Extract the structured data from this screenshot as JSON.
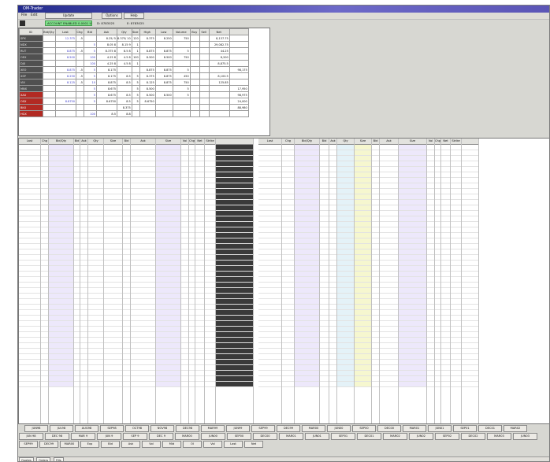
{
  "window": {
    "title": "OM-Trader"
  },
  "menubar": {
    "items": [
      "File",
      "Edit"
    ],
    "tool_buttons": [
      "Update",
      "Options",
      "Help"
    ]
  },
  "toolbar": {
    "green_label": "ACCOUNT ENABLED 0.0001 USD",
    "info_1": "D:  8783025",
    "info_2": "E:  8783025"
  },
  "top_table": {
    "headers": [
      "ID",
      "Bid/Qty",
      "Last",
      "Chg",
      "Bid",
      "Ask",
      "Qty",
      "Size",
      "High",
      "Low",
      "Volume",
      "Buy",
      "Sell",
      "Net"
    ],
    "rows": [
      {
        "label": "SPX",
        "red": false,
        "cells": [
          "",
          "12.375",
          "-5",
          "",
          "8.25/ 5",
          "8.375/ 10",
          "120",
          "8.375",
          "8.250",
          "750",
          "",
          "",
          "8,137.75"
        ]
      },
      {
        "label": "NDX",
        "red": false,
        "cells": [
          "",
          "",
          "",
          "5",
          "8.05 8",
          "8.15 9",
          "1",
          "",
          "",
          "",
          "",
          "",
          "29,082.75"
        ]
      },
      {
        "label": "RUT",
        "red": false,
        "cells": [
          "",
          "8.875",
          "-5",
          "5",
          "8.375 8",
          "8.5 8",
          "1",
          "8.875",
          "8.875",
          "5",
          "",
          "",
          "44.25"
        ]
      },
      {
        "label": "OEX",
        "red": false,
        "cells": [
          "",
          "8.500",
          "",
          "100",
          "4.25 8",
          "4.5 8",
          "100",
          "8.500",
          "8.500",
          "750",
          "",
          "",
          "8,200"
        ]
      },
      {
        "label": "DJX",
        "red": false,
        "cells": [
          "",
          "",
          "",
          "100",
          "4.25 8",
          "4.5 8",
          "1",
          "",
          "",
          "",
          "",
          "",
          "8,875.5"
        ]
      },
      {
        "label": "XEO",
        "red": false,
        "cells": [
          "",
          "8.875",
          "-5",
          "5",
          "8.175",
          "",
          "",
          "8.875",
          "8.875",
          "5",
          "",
          "",
          "",
          "98,175"
        ]
      },
      {
        "label": "XSP",
        "red": false,
        "cells": [
          "",
          "8.250",
          "-5",
          "5",
          "8.175",
          "8.5",
          "5",
          "8.375",
          "8.875",
          "450",
          "",
          "",
          "8,100.5"
        ]
      },
      {
        "label": "VIX",
        "red": false,
        "cells": [
          "",
          "8.125",
          "-5",
          "10",
          "8.875",
          "8.5",
          "5",
          "8.125",
          "8.875",
          "750",
          "",
          "",
          "125.85"
        ]
      },
      {
        "label": "MNX",
        "red": false,
        "cells": [
          "",
          "",
          "",
          "5",
          "8.675",
          "",
          "5",
          "8.500",
          "",
          "5",
          "",
          "",
          "",
          "17,950"
        ]
      },
      {
        "label": "XAU",
        "red": true,
        "cells": [
          "",
          "",
          "",
          "5",
          "8.675",
          "8.5",
          "5",
          "8.500",
          "8.500",
          "5",
          "",
          "",
          "",
          "98,975"
        ]
      },
      {
        "label": "OSX",
        "red": true,
        "cells": [
          "",
          "8.8750",
          "",
          "5",
          "8.6750",
          "8.5",
          "5",
          "8.6750",
          "",
          "",
          "",
          "",
          "",
          "24,000"
        ]
      },
      {
        "label": "BKX",
        "red": true,
        "cells": [
          "",
          "",
          "",
          "",
          "",
          "8.375",
          "",
          "",
          "",
          "",
          "",
          "",
          "",
          "88,980"
        ]
      },
      {
        "label": "HGX",
        "red": true,
        "cells": [
          "",
          "",
          "",
          "100",
          "8.5",
          "8.8",
          "",
          "",
          "",
          "",
          "",
          "",
          "",
          ""
        ]
      }
    ]
  },
  "grid": {
    "headers_left": [
      "Last",
      "Chg",
      "Bid/Qty",
      "Bid",
      "Ask",
      "Qty",
      "Size",
      "Bid",
      "Ask",
      "Size",
      "Vol",
      "Chg",
      "Net",
      "Strike"
    ],
    "headers_right": [
      "Last",
      "Chg",
      "Bid/Qty",
      "Bid",
      "Ask",
      "Qty",
      "Size",
      "Bid",
      "Ask",
      "Size",
      "Vol",
      "Chg",
      "Net",
      "Strike"
    ]
  },
  "tabs": {
    "row1": [
      "JUN98",
      "JUL98",
      "AUG98",
      "SEP98",
      "OCT98",
      "NOV98",
      "DEC98",
      "MAR99",
      "JUN99",
      "SEP99",
      "DEC99",
      "MAR00",
      "JUN00",
      "SEP00",
      "DEC00",
      "MAR01",
      "JUN01",
      "SEP01",
      "DEC01",
      "MAR02"
    ],
    "row2": [
      "JUN 98",
      "DEC 98",
      "MAR 9",
      "JUN 9",
      "SEP 9",
      "DEC 9",
      "MAR00",
      "JUN00",
      "SEP00",
      "DEC00",
      "MAR01",
      "JUN01",
      "SEP01",
      "DEC01",
      "MAR02",
      "JUN02",
      "SEP02",
      "DEC02",
      "MAR03",
      "JUN03"
    ],
    "row3": [
      "SEP99",
      "DEC99",
      "MAR00",
      "Exp",
      "Bid",
      "Ask",
      "Vol",
      "Mid",
      "OI",
      "Vol",
      "Last",
      "Net"
    ]
  },
  "status": {
    "tabs": [
      "Quotes",
      "Orders",
      "Fills"
    ]
  }
}
